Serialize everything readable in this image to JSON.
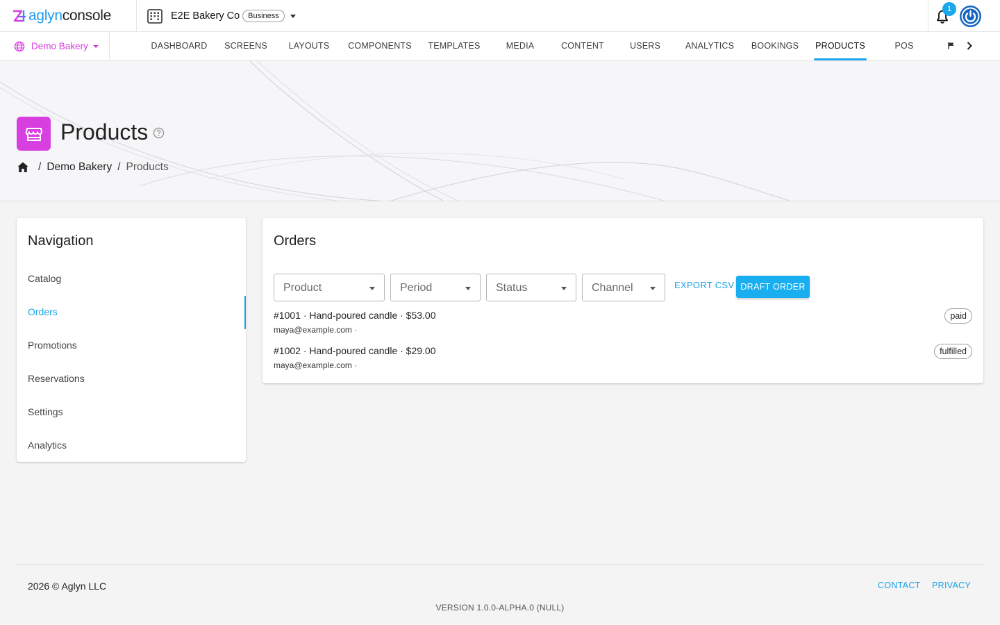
{
  "app": {
    "logo_part1": "aglyn",
    "logo_part2": "console"
  },
  "org": {
    "name": "E2E Bakery Co",
    "badge": "Business"
  },
  "notifications": {
    "count": "1"
  },
  "site": {
    "name": "Demo Bakery"
  },
  "nav": {
    "tabs": [
      {
        "label": "DASHBOARD"
      },
      {
        "label": "SCREENS"
      },
      {
        "label": "LAYOUTS"
      },
      {
        "label": "COMPONENTS"
      },
      {
        "label": "TEMPLATES"
      },
      {
        "label": "MEDIA"
      },
      {
        "label": "CONTENT"
      },
      {
        "label": "USERS"
      },
      {
        "label": "ANALYTICS"
      },
      {
        "label": "BOOKINGS"
      },
      {
        "label": "PRODUCTS"
      },
      {
        "label": "POS"
      }
    ],
    "active": "PRODUCTS"
  },
  "page": {
    "title": "Products",
    "breadcrumb": [
      "Demo Bakery",
      "Products"
    ]
  },
  "sidebar": {
    "title": "Navigation",
    "items": [
      {
        "label": "Catalog"
      },
      {
        "label": "Orders"
      },
      {
        "label": "Promotions"
      },
      {
        "label": "Reservations"
      },
      {
        "label": "Settings"
      },
      {
        "label": "Analytics"
      }
    ],
    "active": "Orders"
  },
  "orders": {
    "title": "Orders",
    "filters": [
      {
        "label": "Product"
      },
      {
        "label": "Period"
      },
      {
        "label": "Status"
      },
      {
        "label": "Channel"
      }
    ],
    "export_label": "EXPORT CSV",
    "draft_label": "DRAFT ORDER",
    "rows": [
      {
        "summary": "#1001 · Hand-poured candle · $53.00",
        "email": "maya@example.com ·",
        "status": "paid"
      },
      {
        "summary": "#1002 · Hand-poured candle · $29.00",
        "email": "maya@example.com ·",
        "status": "fulfilled"
      }
    ]
  },
  "footer": {
    "copyright": "2026 © Aglyn LLC",
    "contact": "CONTACT",
    "privacy": "PRIVACY",
    "version": "VERSION 1.0.0-ALPHA.0 (NULL)"
  },
  "colors": {
    "accent": "#1aa3e8",
    "brand_magenta": "#d83fe0",
    "power_button": "#1565c0"
  },
  "icons": {
    "org": "building-icon",
    "notifications": "bell-icon",
    "account": "power-icon",
    "site": "globe-icon",
    "page": "storefront-icon",
    "help": "help-circle-icon",
    "home": "home-icon"
  }
}
